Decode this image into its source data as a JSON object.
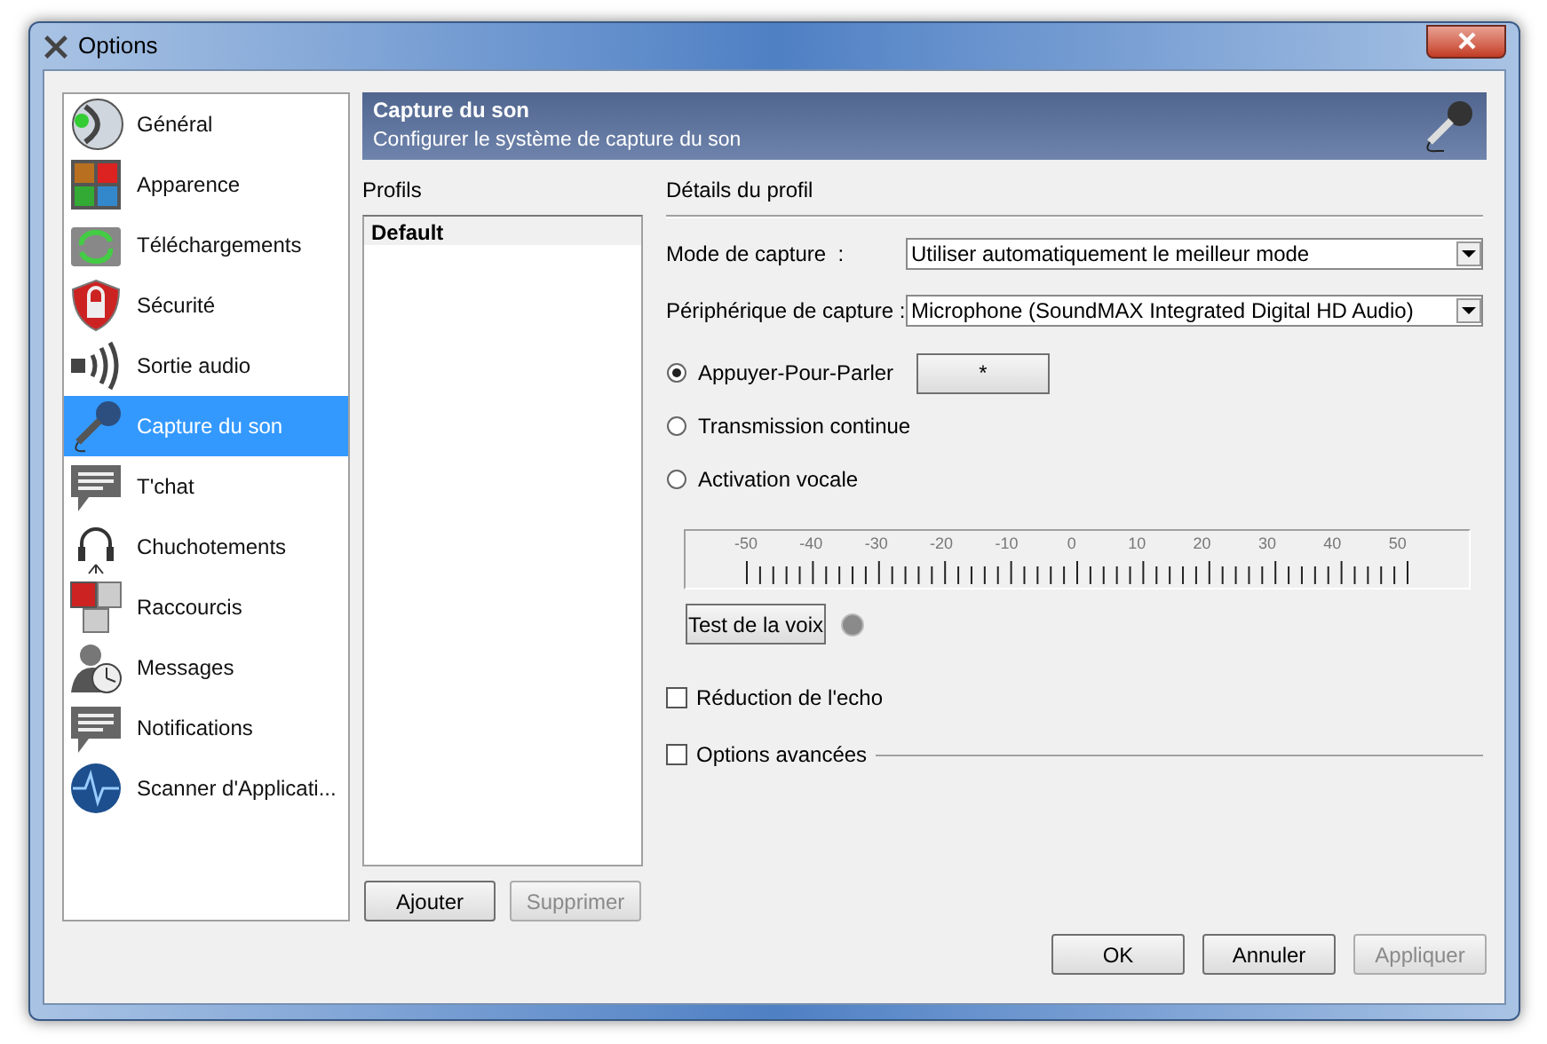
{
  "window": {
    "title": "Options"
  },
  "sidebar": {
    "items": [
      {
        "label": "Général",
        "selected": false
      },
      {
        "label": "Apparence",
        "selected": false
      },
      {
        "label": "Téléchargements",
        "selected": false
      },
      {
        "label": "Sécurité",
        "selected": false
      },
      {
        "label": "Sortie audio",
        "selected": false
      },
      {
        "label": "Capture du son",
        "selected": true
      },
      {
        "label": "T'chat",
        "selected": false
      },
      {
        "label": "Chuchotements",
        "selected": false
      },
      {
        "label": "Raccourcis",
        "selected": false
      },
      {
        "label": "Messages",
        "selected": false
      },
      {
        "label": "Notifications",
        "selected": false
      },
      {
        "label": "Scanner d'Applicati...",
        "selected": false
      }
    ]
  },
  "header": {
    "title": "Capture du son",
    "subtitle": "Configurer le système de capture du son"
  },
  "profiles": {
    "label": "Profils",
    "items": [
      {
        "label": "Default",
        "selected": true
      }
    ],
    "buttons": [
      {
        "label": "Ajouter",
        "disabled": false
      },
      {
        "label": "Supprimer",
        "disabled": true
      }
    ]
  },
  "details": {
    "label": "Détails du profil",
    "fields": [
      {
        "label": "Mode de capture  :",
        "value": "Utiliser automatiquement le meilleur mode"
      },
      {
        "label": "Périphérique de capture :",
        "value": "Microphone (SoundMAX Integrated Digital HD Audio)"
      }
    ],
    "modes": [
      {
        "label": "Appuyer-Pour-Parler",
        "selected": true,
        "hotkey": "*"
      },
      {
        "label": "Transmission continue",
        "selected": false
      },
      {
        "label": "Activation vocale",
        "selected": false
      }
    ],
    "scale": [
      "-50",
      "-40",
      "-30",
      "-20",
      "-10",
      "0",
      "10",
      "20",
      "30",
      "40",
      "50"
    ],
    "test_button": "Test de la voix",
    "indicator": {
      "on": false
    },
    "checkboxes": [
      {
        "label": "Réduction de l'echo",
        "checked": false
      },
      {
        "label": "Options avancées",
        "checked": false
      }
    ]
  },
  "buttons": [
    {
      "label": "OK",
      "disabled": false
    },
    {
      "label": "Annuler",
      "disabled": false
    },
    {
      "label": "Appliquer",
      "disabled": true
    }
  ]
}
